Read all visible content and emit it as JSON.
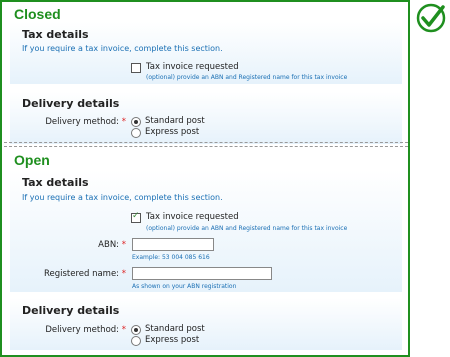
{
  "closed": {
    "title": "Closed",
    "tax": {
      "heading": "Tax details",
      "hint": "If you require a tax invoice, complete this section.",
      "checkbox_label": "Tax invoice requested",
      "checkbox_note": "(optional) provide an ABN and Registered name for this tax invoice",
      "checked": false
    },
    "delivery": {
      "heading": "Delivery details",
      "label": "Delivery method:",
      "required": "*",
      "options": [
        "Standard post",
        "Express post"
      ],
      "selected": "Standard post"
    }
  },
  "open": {
    "title": "Open",
    "tax": {
      "heading": "Tax details",
      "hint": "If you require a tax invoice, complete this section.",
      "checkbox_label": "Tax invoice requested",
      "checkbox_note": "(optional) provide an ABN and Registered name for this tax invoice",
      "checked": true,
      "abn_label": "ABN:",
      "abn_value": "",
      "abn_example": "Example: 53 004 085 616",
      "registered_label": "Registered name:",
      "registered_value": "",
      "registered_hint": "As shown on your ABN registration",
      "required": "*"
    },
    "delivery": {
      "heading": "Delivery details",
      "label": "Delivery method:",
      "required": "*",
      "options": [
        "Standard post",
        "Express post"
      ],
      "selected": "Standard post"
    }
  },
  "colors": {
    "frame_green": "#1f8f1f",
    "hint_blue": "#1a6fb4",
    "required_red": "#d22"
  },
  "badge_icon": "checkmark-circle-icon"
}
